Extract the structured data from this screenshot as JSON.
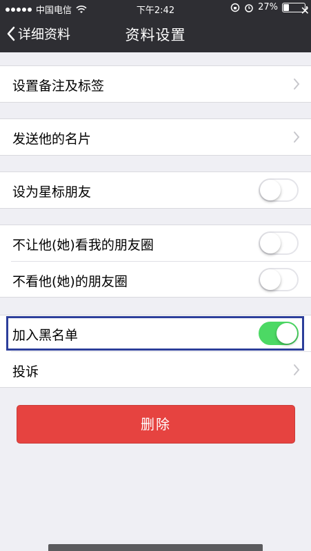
{
  "status_bar": {
    "carrier": "中国电信",
    "time": "下午2:42",
    "battery_percent": "27%",
    "battery_level": 0.27
  },
  "nav": {
    "back_label": "详细资料",
    "title": "资料设置"
  },
  "groups": [
    {
      "items": [
        {
          "label": "设置备注及标签",
          "control": "chevron"
        }
      ]
    },
    {
      "items": [
        {
          "label": "发送他的名片",
          "control": "chevron"
        }
      ]
    },
    {
      "items": [
        {
          "label": "设为星标朋友",
          "control": "toggle",
          "on": false
        }
      ]
    },
    {
      "items": [
        {
          "label": "不让他(她)看我的朋友圈",
          "control": "toggle",
          "on": false
        },
        {
          "label": "不看他(她)的朋友圈",
          "control": "toggle",
          "on": false
        }
      ]
    },
    {
      "items": [
        {
          "label": "加入黑名单",
          "control": "toggle",
          "on": true
        },
        {
          "label": "投诉",
          "control": "chevron"
        }
      ]
    }
  ],
  "delete_button": {
    "label": "删除"
  },
  "colors": {
    "nav_background": "#2e2e33",
    "page_background": "#efeff4",
    "toggle_on": "#4cd964",
    "delete_red": "#e64340",
    "highlight_border": "#2c3e9a"
  }
}
